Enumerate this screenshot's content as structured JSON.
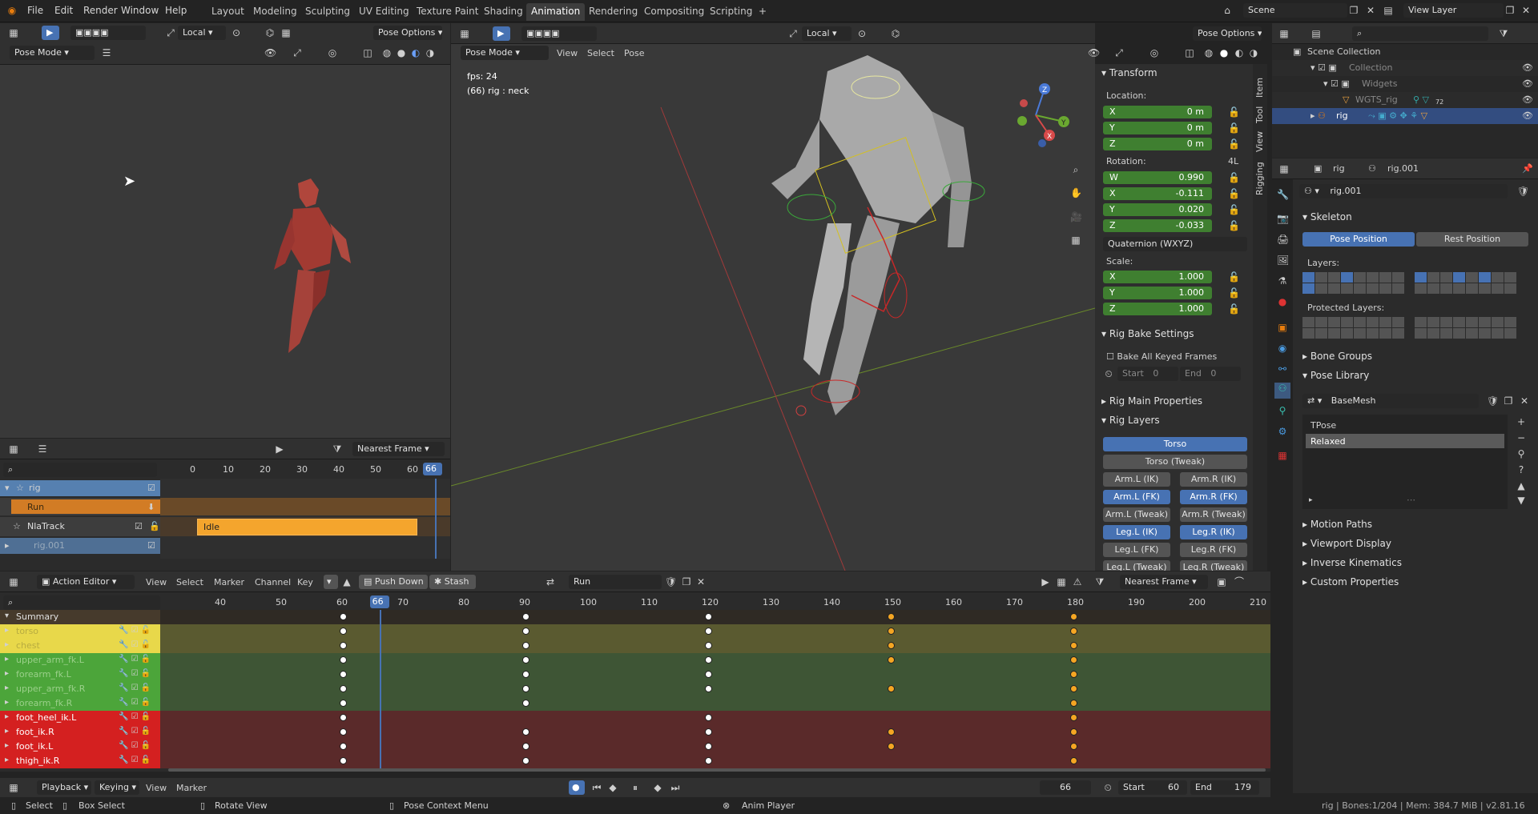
{
  "menu": [
    "File",
    "Edit",
    "Render",
    "Window",
    "Help"
  ],
  "workspaces": [
    "Layout",
    "Modeling",
    "Sculpting",
    "UV Editing",
    "Texture Paint",
    "Shading",
    "Animation",
    "Rendering",
    "Compositing",
    "Scripting"
  ],
  "active_workspace": "Animation",
  "scene": "Scene",
  "view_layer": "View Layer",
  "camview": {
    "orientation": "Local",
    "mode": "Pose Mode",
    "pose_options": "Pose Options"
  },
  "viewport": {
    "mode": "Pose Mode",
    "menus": [
      "View",
      "Select",
      "Pose"
    ],
    "orientation": "Local",
    "pose_options": "Pose Options",
    "fps": "fps: 24",
    "info": "(66) rig : neck",
    "side_tabs": [
      "Item",
      "Tool",
      "View",
      "Rigging"
    ]
  },
  "transform": {
    "title": "Transform",
    "location_label": "Location:",
    "location": [
      [
        "X",
        "0 m"
      ],
      [
        "Y",
        "0 m"
      ],
      [
        "Z",
        "0 m"
      ]
    ],
    "rotation_label": "Rotation:",
    "rotation_mode_short": "4L",
    "rotation": [
      [
        "W",
        "0.990"
      ],
      [
        "X",
        "-0.111"
      ],
      [
        "Y",
        "0.020"
      ],
      [
        "Z",
        "-0.033"
      ]
    ],
    "rotation_mode": "Quaternion (WXYZ)",
    "scale_label": "Scale:",
    "scale": [
      [
        "X",
        "1.000"
      ],
      [
        "Y",
        "1.000"
      ],
      [
        "Z",
        "1.000"
      ]
    ]
  },
  "rig_bake": {
    "title": "Rig Bake Settings",
    "bake_all": "Bake All Keyed Frames",
    "start_label": "Start",
    "start": "0",
    "end_label": "End",
    "end": "0"
  },
  "rig_main": "Rig Main Properties",
  "rig_layers": {
    "title": "Rig Layers",
    "rows": [
      [
        {
          "l": "Torso",
          "on": true
        }
      ],
      [
        {
          "l": "Torso (Tweak)",
          "on": false
        }
      ],
      [
        {
          "l": "Arm.L (IK)",
          "on": false
        },
        {
          "l": "Arm.R (IK)",
          "on": false
        }
      ],
      [
        {
          "l": "Arm.L (FK)",
          "on": true
        },
        {
          "l": "Arm.R (FK)",
          "on": true
        }
      ],
      [
        {
          "l": "Arm.L (Tweak)",
          "on": false
        },
        {
          "l": "Arm.R (Tweak)",
          "on": false
        }
      ],
      [
        {
          "l": "Leg.L (IK)",
          "on": true
        },
        {
          "l": "Leg.R (IK)",
          "on": true
        }
      ],
      [
        {
          "l": "Leg.L (FK)",
          "on": false
        },
        {
          "l": "Leg.R (FK)",
          "on": false
        }
      ],
      [
        {
          "l": "Leg.L (Tweak)",
          "on": false
        },
        {
          "l": "Leg.R (Tweak)",
          "on": false
        }
      ]
    ]
  },
  "outliner": {
    "items": [
      {
        "label": "Scene Collection",
        "indent": 0
      },
      {
        "label": "Collection",
        "indent": 1
      },
      {
        "label": "Widgets",
        "indent": 2
      },
      {
        "label": "WGTS_rig",
        "indent": 3
      },
      {
        "label": "rig",
        "indent": 1
      }
    ],
    "wgts_count": "72"
  },
  "properties": {
    "object": "rig",
    "data": "rig.001",
    "armature": "rig.001",
    "skeleton": "Skeleton",
    "pose_position": "Pose Position",
    "rest_position": "Rest Position",
    "layers": "Layers:",
    "protected_layers": "Protected Layers:",
    "bone_groups": "Bone Groups",
    "pose_library": "Pose Library",
    "basemesh": "BaseMesh",
    "poses": [
      "TPose",
      "Relaxed"
    ],
    "motion_paths": "Motion Paths",
    "viewport_display": "Viewport Display",
    "inverse_kinematics": "Inverse Kinematics",
    "custom_properties": "Custom Properties"
  },
  "nla": {
    "snap": "Nearest Frame",
    "ticks": [
      "0",
      "10",
      "20",
      "30",
      "40",
      "50",
      "60"
    ],
    "current_frame": "66",
    "tracks": [
      {
        "label": "rig",
        "type": "object"
      },
      {
        "label": "Run",
        "type": "action"
      },
      {
        "label": "NlaTrack",
        "type": "track"
      },
      {
        "label": "rig.001",
        "type": "object2"
      }
    ],
    "strip": "Idle"
  },
  "action_editor": {
    "mode": "Action Editor",
    "menus": [
      "View",
      "Select",
      "Marker",
      "Channel",
      "Key"
    ],
    "push_down": "Push Down",
    "stash": "Stash",
    "action": "Run",
    "snap": "Nearest Frame",
    "ticks": [
      "40",
      "50",
      "60",
      "70",
      "80",
      "90",
      "100",
      "110",
      "120",
      "130",
      "140",
      "150",
      "160",
      "170",
      "180",
      "190",
      "200",
      "210"
    ],
    "current_frame": "66",
    "channels": [
      {
        "label": "Summary",
        "color": "summary"
      },
      {
        "label": "torso",
        "color": "yellow"
      },
      {
        "label": "chest",
        "color": "yellow"
      },
      {
        "label": "upper_arm_fk.L",
        "color": "green"
      },
      {
        "label": "forearm_fk.L",
        "color": "green"
      },
      {
        "label": "upper_arm_fk.R",
        "color": "green"
      },
      {
        "label": "forearm_fk.R",
        "color": "green"
      },
      {
        "label": "foot_heel_ik.L",
        "color": "red"
      },
      {
        "label": "foot_ik.R",
        "color": "red"
      },
      {
        "label": "foot_ik.L",
        "color": "red"
      },
      {
        "label": "thigh_ik.R",
        "color": "red"
      }
    ]
  },
  "playback": {
    "menus": [
      "Playback",
      "Keying",
      "View",
      "Marker"
    ],
    "frame": "66",
    "start_label": "Start",
    "start": "60",
    "end_label": "End",
    "end": "179"
  },
  "status": {
    "select": "Select",
    "box_select": "Box Select",
    "rotate": "Rotate View",
    "context": "Pose Context Menu",
    "anim_player": "Anim Player",
    "info": "rig | Bones:1/204 | Mem: 384.7 MiB | v2.81.16"
  }
}
